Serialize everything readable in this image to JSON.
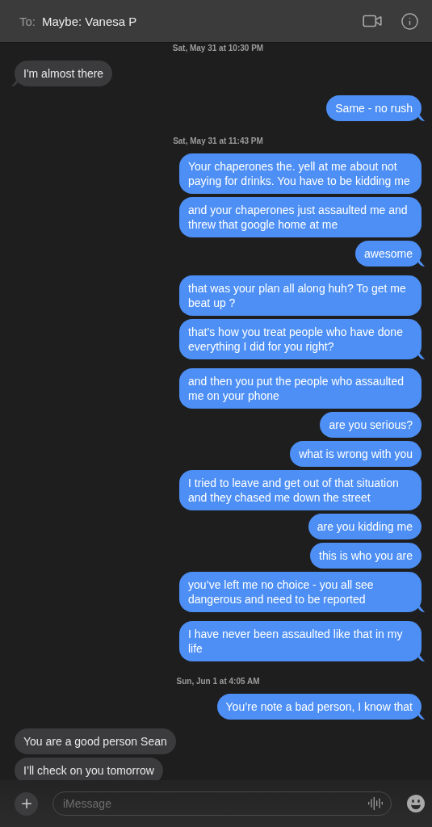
{
  "header": {
    "to_label": "To:",
    "recipient": "Maybe: Vanesa P"
  },
  "messages": [
    {
      "kind": "timestamp",
      "text": "Sat, May 31 at 10:30 PM"
    },
    {
      "kind": "message",
      "outgoing": false,
      "text": "I'm almost there",
      "tail": true
    },
    {
      "kind": "message",
      "outgoing": true,
      "text": "Same - no rush",
      "tail": true
    },
    {
      "kind": "timestamp",
      "text": "Sat, May 31 at 11:43 PM"
    },
    {
      "kind": "message",
      "outgoing": true,
      "text": "Your chaperones the. yell at me about not paying for drinks. You have to be kidding me",
      "tail": false
    },
    {
      "kind": "message",
      "outgoing": true,
      "text": "and your chaperones just assaulted me and threw that google home at me",
      "tail": false
    },
    {
      "kind": "message",
      "outgoing": true,
      "text": "awesome",
      "tail": true
    },
    {
      "kind": "message",
      "outgoing": true,
      "text": "that was your plan all along huh? To get me beat up ?",
      "tail": false
    },
    {
      "kind": "message",
      "outgoing": true,
      "text": "that’s how you treat people who have done everything I did for you right?",
      "tail": true
    },
    {
      "kind": "message",
      "outgoing": true,
      "text": "and then you put the people who assaulted me on your phone",
      "tail": false
    },
    {
      "kind": "message",
      "outgoing": true,
      "text": "are you serious?",
      "tail": false
    },
    {
      "kind": "message",
      "outgoing": true,
      "text": "what is wrong with you",
      "tail": false
    },
    {
      "kind": "message",
      "outgoing": true,
      "text": "I tried to leave and get out of that situation and they chased me down the street",
      "tail": false
    },
    {
      "kind": "message",
      "outgoing": true,
      "text": "are you kidding me",
      "tail": false
    },
    {
      "kind": "message",
      "outgoing": true,
      "text": "this is who you are",
      "tail": false
    },
    {
      "kind": "message",
      "outgoing": true,
      "text": "you’ve left me no choice - you all see dangerous and need to be reported",
      "tail": true
    },
    {
      "kind": "message",
      "outgoing": true,
      "text": "I have never been assaulted like that in my life",
      "tail": true
    },
    {
      "kind": "timestamp",
      "text": "Sun, Jun 1 at 4:05 AM"
    },
    {
      "kind": "message",
      "outgoing": true,
      "text": "You’re note a bad person, I know that",
      "tail": true
    },
    {
      "kind": "message",
      "outgoing": false,
      "text": "You are a good person Sean",
      "tail": false
    },
    {
      "kind": "message",
      "outgoing": false,
      "text": "I’ll check on you tomorrow",
      "tail": false
    }
  ],
  "composer": {
    "placeholder": "iMessage"
  }
}
